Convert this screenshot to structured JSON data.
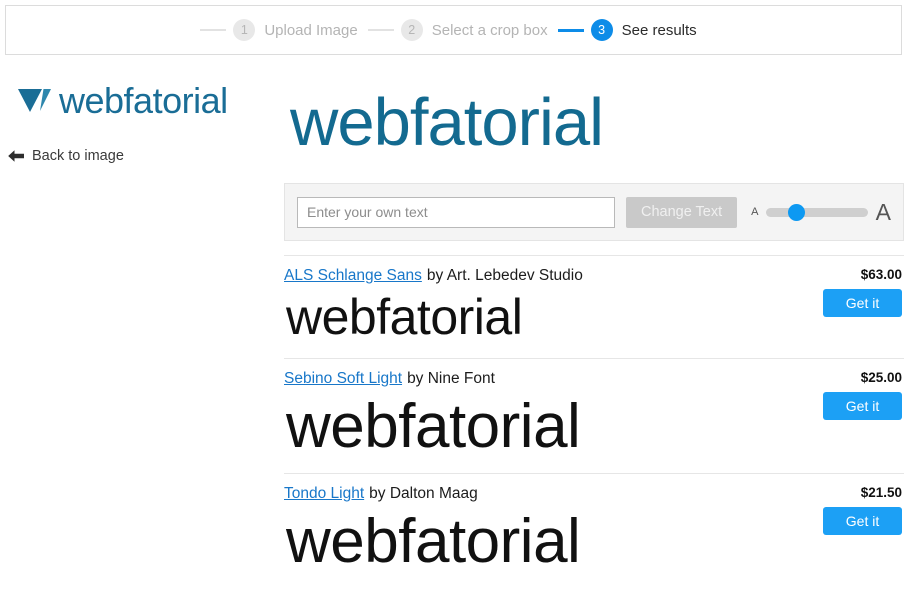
{
  "stepper": {
    "steps": [
      {
        "number": "1",
        "label": "Upload Image",
        "active": false
      },
      {
        "number": "2",
        "label": "Select a crop box",
        "active": false
      },
      {
        "number": "3",
        "label": "See results",
        "active": true
      }
    ]
  },
  "sidebar": {
    "logo_text": "webfatorial",
    "logo_icon": "webfatorial-triangle-logo",
    "back_link": {
      "icon": "arrow-left-icon",
      "label": "Back to image"
    }
  },
  "preview": {
    "text": "webfatorial"
  },
  "toolbar": {
    "input_placeholder": "Enter your own text",
    "input_value": "",
    "change_text_label": "Change Text",
    "size_small_label": "A",
    "size_large_label": "A",
    "slider_position_percent": 30
  },
  "results": [
    {
      "font_name": "ALS Schlange Sans",
      "by_text": "by Art. Lebedev Studio",
      "price": "$63.00",
      "buy_label": "Get it",
      "sample_text": "webfatorial"
    },
    {
      "font_name": "Sebino Soft Light",
      "by_text": "by Nine Font",
      "price": "$25.00",
      "buy_label": "Get it",
      "sample_text": "webfatorial"
    },
    {
      "font_name": "Tondo Light",
      "by_text": "by Dalton Maag",
      "price": "$21.50",
      "buy_label": "Get it",
      "sample_text": "webfatorial"
    }
  ],
  "colors": {
    "accent_blue": "#1ca0f5",
    "step_active": "#0d8ce8",
    "link_blue": "#1877c9",
    "brand_teal": "#1a6d96",
    "preview_teal": "#136a90"
  }
}
